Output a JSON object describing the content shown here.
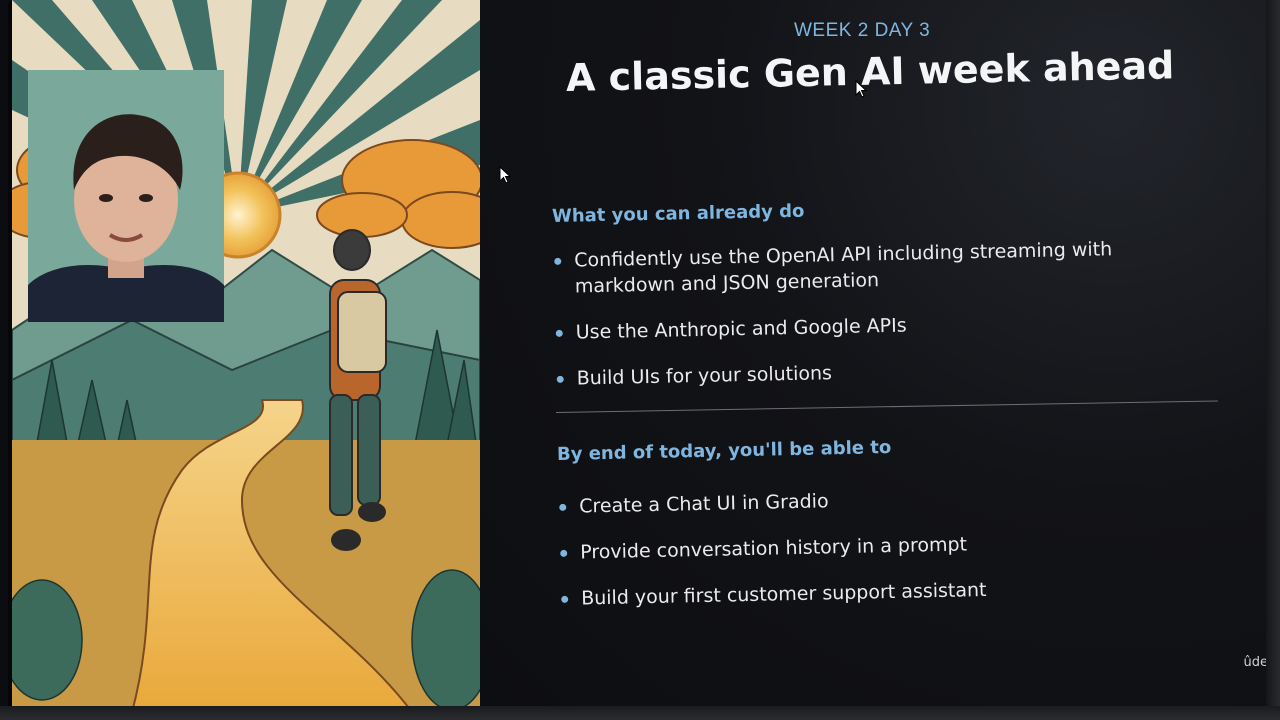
{
  "slide": {
    "kicker": "WEEK 2 DAY 3",
    "title": "A classic Gen AI week ahead",
    "section_already": "What you can already do",
    "already_items": [
      "Confidently use the OpenAI API including streaming with markdown and JSON generation",
      "Use the Anthropic and Google APIs",
      "Build UIs for your solutions"
    ],
    "section_today": "By end of today, you'll be able to",
    "today_items": [
      "Create a Chat UI in Gradio",
      "Provide conversation history in a prompt",
      "Build your first customer support assistant"
    ],
    "corner_brand": "ûde"
  },
  "colors": {
    "accent": "#7fb6e0",
    "slide_bg": "#121317",
    "sun": "#e8a23c",
    "teal": "#3f6f67"
  },
  "icons": [
    "mouse-pointer-icon"
  ]
}
